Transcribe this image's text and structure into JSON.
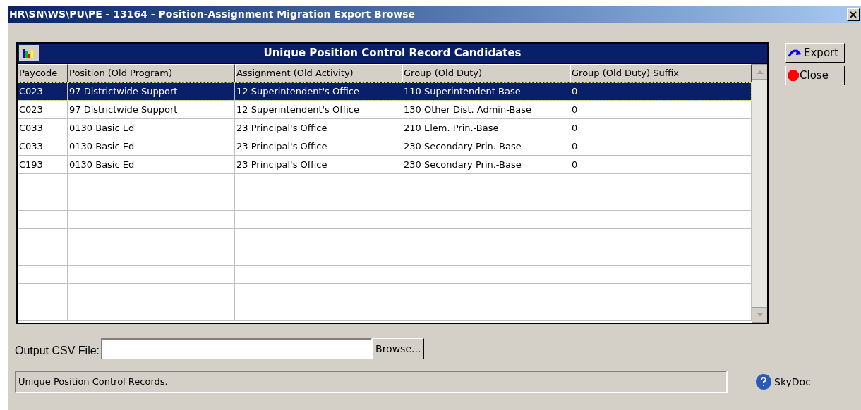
{
  "window": {
    "title": "HR\\SN\\WS\\PU\\PE - 13164 - Position-Assignment Migration Export Browse",
    "close": "×"
  },
  "grid": {
    "title": "Unique Position Control Record Candidates",
    "columns": [
      "Paycode",
      "Position (Old Program)",
      "Assignment (Old Activity)",
      "Group (Old Duty)",
      "Group (Old Duty) Suffix"
    ],
    "rows": [
      {
        "selected": true,
        "cells": [
          "C023",
          "97 Districtwide Support",
          "12 Superintendent's Office",
          "110 Superintendent-Base",
          "0"
        ]
      },
      {
        "selected": false,
        "cells": [
          "C023",
          "97 Districtwide Support",
          "12 Superintendent's Office",
          "130 Other Dist. Admin-Base",
          "0"
        ]
      },
      {
        "selected": false,
        "cells": [
          "C033",
          "0130 Basic Ed",
          "23 Principal's Office",
          "210 Elem. Prin.-Base",
          "0"
        ]
      },
      {
        "selected": false,
        "cells": [
          "C033",
          "0130 Basic Ed",
          "23 Principal's Office",
          "230 Secondary Prin.-Base",
          "0"
        ]
      },
      {
        "selected": false,
        "cells": [
          "C193",
          "0130 Basic Ed",
          "23 Principal's Office",
          "230 Secondary Prin.-Base",
          "0"
        ]
      }
    ]
  },
  "buttons": [
    "Export",
    "Close"
  ],
  "output": {
    "label": "Output CSV File:",
    "browse": "Browse..."
  },
  "status_bar": "Unique Position Control Records.",
  "help": "SkyDoc"
}
